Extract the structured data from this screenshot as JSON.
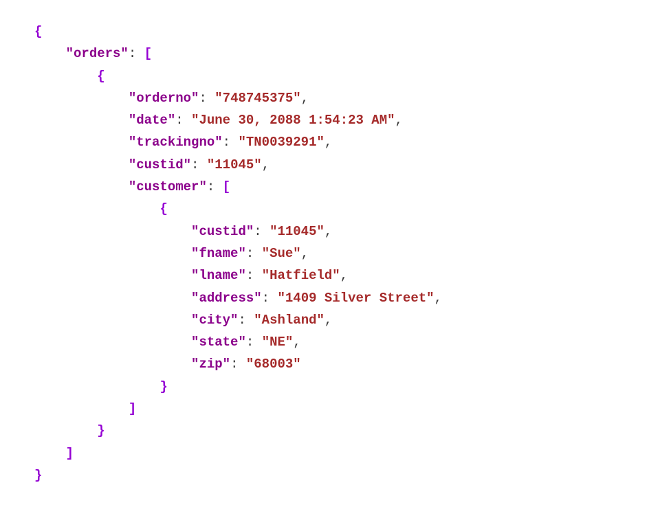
{
  "code": {
    "k_orders": "\"orders\"",
    "k_orderno": "\"orderno\"",
    "v_orderno": "\"748745375\"",
    "k_date": "\"date\"",
    "v_date": "\"June 30, 2088 1:54:23 AM\"",
    "k_trackingno": "\"trackingno\"",
    "v_trackingno": "\"TN0039291\"",
    "k_custid": "\"custid\"",
    "v_custid": "\"11045\"",
    "k_customer": "\"customer\"",
    "k_c_custid": "\"custid\"",
    "v_c_custid": "\"11045\"",
    "k_fname": "\"fname\"",
    "v_fname": "\"Sue\"",
    "k_lname": "\"lname\"",
    "v_lname": "\"Hatfield\"",
    "k_address": "\"address\"",
    "v_address": "\"1409 Silver Street\"",
    "k_city": "\"city\"",
    "v_city": "\"Ashland\"",
    "k_state": "\"state\"",
    "v_state": "\"NE\"",
    "k_zip": "\"zip\"",
    "v_zip": "\"68003\""
  }
}
